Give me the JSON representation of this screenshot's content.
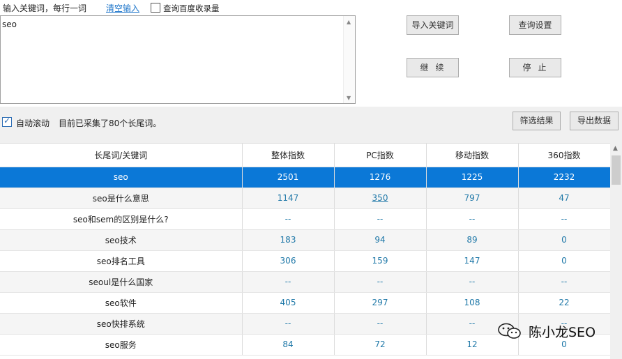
{
  "top": {
    "label": "输入关键词，每行一词",
    "clear_link": "清空输入",
    "baidu_checkbox_label": "查询百度收录量",
    "baidu_checked": false
  },
  "keywords": {
    "value": "seo"
  },
  "buttons": {
    "import": "导入关键词",
    "settings": "查询设置",
    "continue": "继续",
    "stop": "停止",
    "filter": "筛选结果",
    "export": "导出数据"
  },
  "status": {
    "autoscroll_label": "自动滚动",
    "autoscroll_checked": true,
    "text": "目前已采集了80个长尾词。"
  },
  "table": {
    "headers": [
      "长尾词/关键词",
      "整体指数",
      "PC指数",
      "移动指数",
      "360指数"
    ],
    "rows": [
      [
        "seo",
        "2501",
        "1276",
        "1225",
        "2232"
      ],
      [
        "seo是什么意思",
        "1147",
        "350",
        "797",
        "47"
      ],
      [
        "seo和sem的区别是什么?",
        "--",
        "--",
        "--",
        "--"
      ],
      [
        "seo技术",
        "183",
        "94",
        "89",
        "0"
      ],
      [
        "seo排名工具",
        "306",
        "159",
        "147",
        "0"
      ],
      [
        "seoul是什么国家",
        "--",
        "--",
        "--",
        "--"
      ],
      [
        "seo软件",
        "405",
        "297",
        "108",
        "22"
      ],
      [
        "seo快排系统",
        "--",
        "--",
        "--",
        "--"
      ],
      [
        "seo服务",
        "84",
        "72",
        "12",
        "0"
      ]
    ],
    "selected_row": 0
  },
  "watermark": {
    "text": "陈小龙SEO",
    "icon": "wechat-icon"
  },
  "colors": {
    "selection": "#0b78d7",
    "link": "#1a73c9",
    "value_text": "#1f78a8"
  }
}
